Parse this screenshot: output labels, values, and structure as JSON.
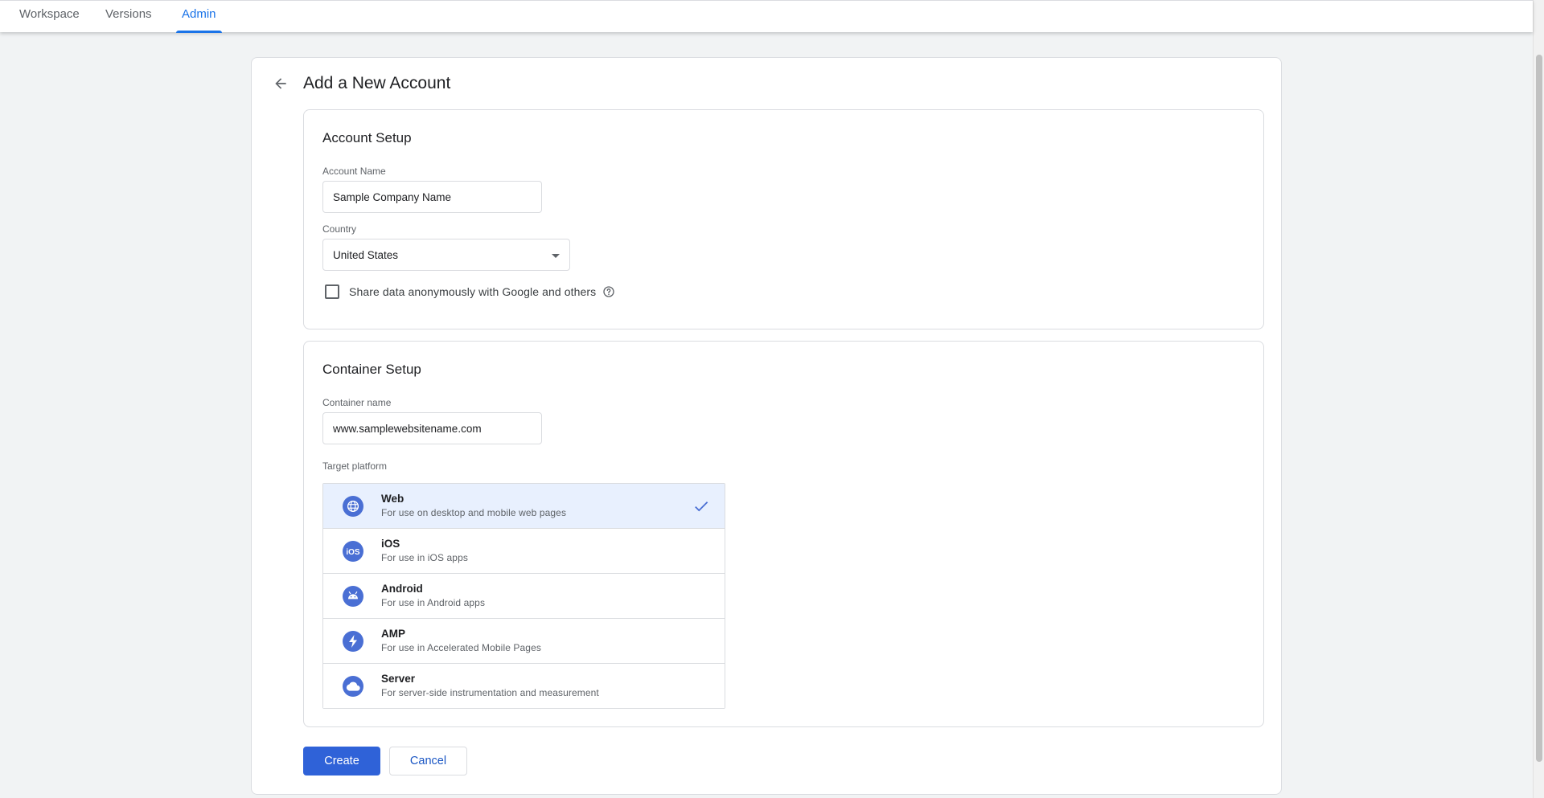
{
  "nav": {
    "tabs": [
      {
        "label": "Workspace"
      },
      {
        "label": "Versions"
      },
      {
        "label": "Admin"
      }
    ],
    "active_tab": "Admin"
  },
  "page": {
    "title": "Add a New Account"
  },
  "account_setup": {
    "title": "Account Setup",
    "account_name_label": "Account Name",
    "account_name_value": "Sample Company Name",
    "country_label": "Country",
    "country_value": "United States",
    "share_data_label": "Share data anonymously with Google and others",
    "share_data_checked": false
  },
  "container_setup": {
    "title": "Container Setup",
    "container_name_label": "Container name",
    "container_name_value": "www.samplewebsitename.com",
    "target_platform_label": "Target platform",
    "platforms": [
      {
        "name": "Web",
        "description": "For use on desktop and mobile web pages",
        "icon": "globe-icon",
        "selected": true
      },
      {
        "name": "iOS",
        "description": "For use in iOS apps",
        "icon": "ios-icon",
        "selected": false
      },
      {
        "name": "Android",
        "description": "For use in Android apps",
        "icon": "android-icon",
        "selected": false
      },
      {
        "name": "AMP",
        "description": "For use in Accelerated Mobile Pages",
        "icon": "amp-bolt-icon",
        "selected": false
      },
      {
        "name": "Server",
        "description": "For server-side instrumentation and measurement",
        "icon": "cloud-icon",
        "selected": false
      }
    ]
  },
  "actions": {
    "create_label": "Create",
    "cancel_label": "Cancel"
  },
  "colors": {
    "accent": "#1a73e8",
    "primary_button": "#2f62d8",
    "selected_row": "#e8f0fe",
    "platform_icon": "#4a6fd4"
  }
}
